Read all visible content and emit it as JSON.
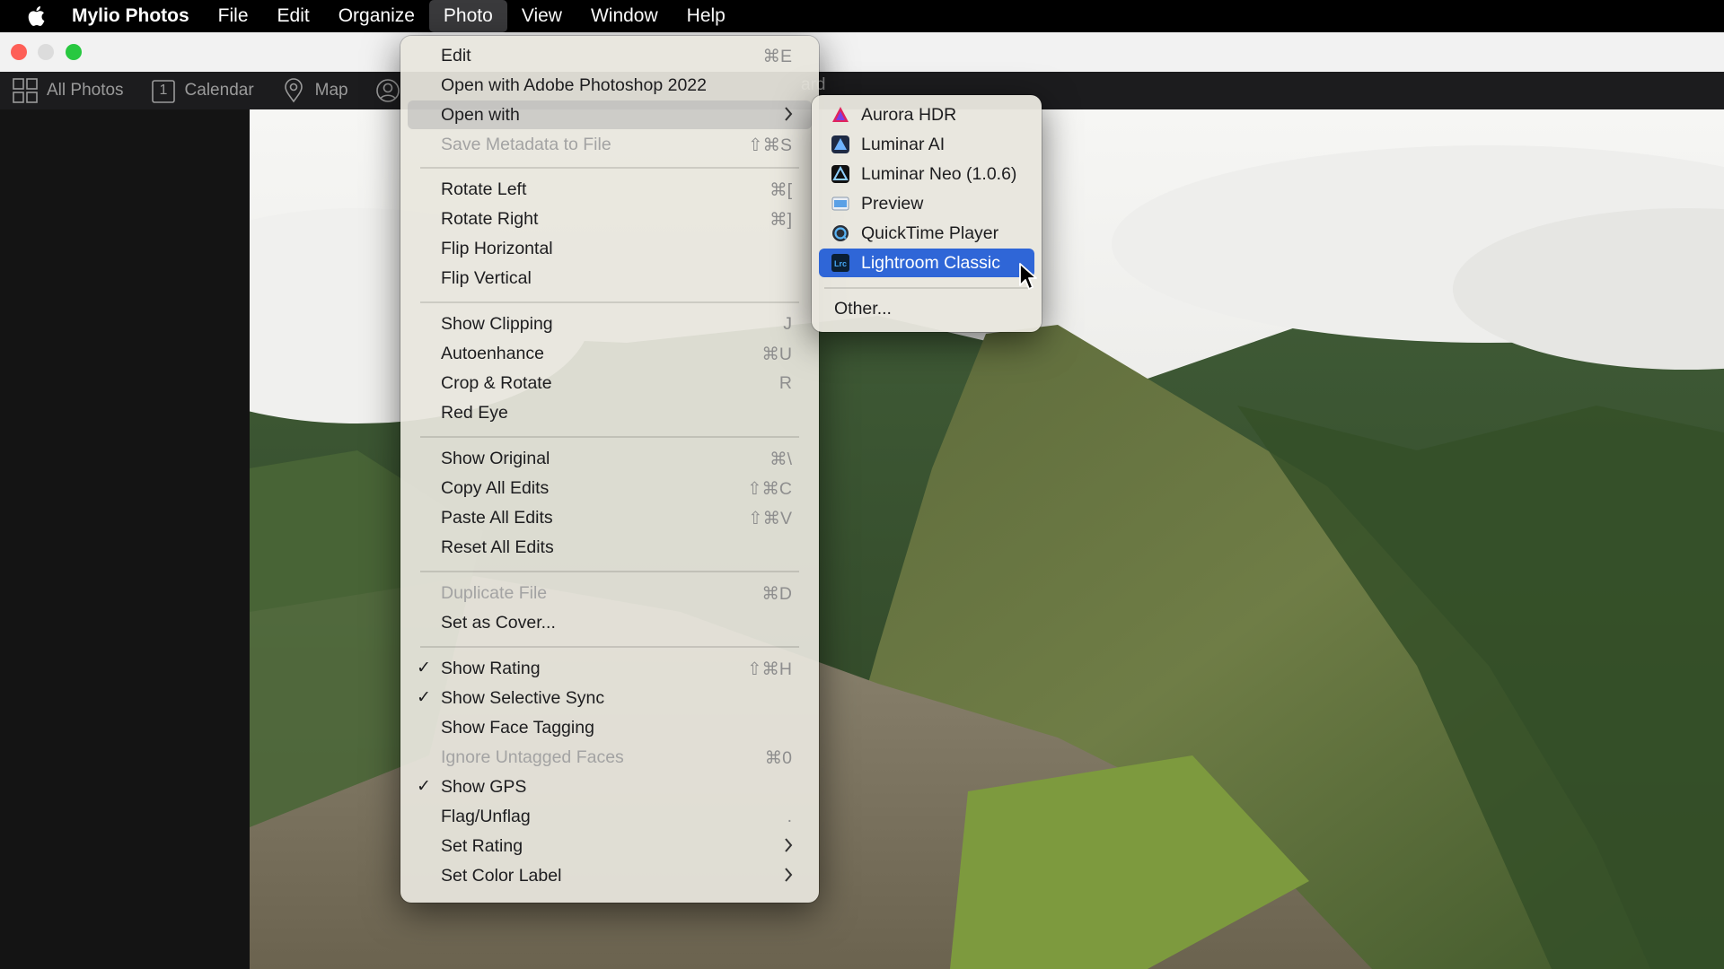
{
  "menubar": {
    "app_name": "Mylio Photos",
    "menus": [
      "File",
      "Edit",
      "Organize",
      "Photo",
      "View",
      "Window",
      "Help"
    ],
    "active_menu": "Photo"
  },
  "toolbar": {
    "all_photos": "All Photos",
    "calendar": "Calendar",
    "calendar_day": "1",
    "map": "Map",
    "partial_label": "ard"
  },
  "photo_menu": {
    "items": [
      {
        "label": "Edit",
        "shortcut": "⌘E"
      },
      {
        "label": "Open with Adobe Photoshop 2022",
        "shortcut": ""
      },
      {
        "label": "Open with",
        "shortcut": ""
      },
      {
        "label": "Save Metadata to File",
        "shortcut": "⇧⌘S"
      },
      {
        "label": "Rotate Left",
        "shortcut": "⌘["
      },
      {
        "label": "Rotate Right",
        "shortcut": "⌘]"
      },
      {
        "label": "Flip Horizontal",
        "shortcut": ""
      },
      {
        "label": "Flip Vertical",
        "shortcut": ""
      },
      {
        "label": "Show Clipping",
        "shortcut": "J"
      },
      {
        "label": "Autoenhance",
        "shortcut": "⌘U"
      },
      {
        "label": "Crop & Rotate",
        "shortcut": "R"
      },
      {
        "label": "Red Eye",
        "shortcut": ""
      },
      {
        "label": "Show Original",
        "shortcut": "⌘\\"
      },
      {
        "label": "Copy All Edits",
        "shortcut": "⇧⌘C"
      },
      {
        "label": "Paste All Edits",
        "shortcut": "⇧⌘V"
      },
      {
        "label": "Reset All Edits",
        "shortcut": ""
      },
      {
        "label": "Duplicate File",
        "shortcut": "⌘D"
      },
      {
        "label": "Set as Cover...",
        "shortcut": ""
      },
      {
        "label": "Show Rating",
        "shortcut": "⇧⌘H"
      },
      {
        "label": "Show Selective Sync",
        "shortcut": ""
      },
      {
        "label": "Show Face Tagging",
        "shortcut": ""
      },
      {
        "label": "Ignore Untagged Faces",
        "shortcut": "⌘0"
      },
      {
        "label": "Show GPS",
        "shortcut": ""
      },
      {
        "label": "Flag/Unflag",
        "shortcut": "."
      },
      {
        "label": "Set Rating",
        "shortcut": ""
      },
      {
        "label": "Set Color Label",
        "shortcut": ""
      }
    ],
    "checkmark": "✓"
  },
  "open_with_menu": {
    "items": [
      "Aurora HDR",
      "Luminar AI",
      "Luminar Neo (1.0.6)",
      "Preview",
      "QuickTime Player",
      "Lightroom Classic",
      "Other..."
    ],
    "lrc_badge": "Lrc"
  },
  "colors": {
    "selection": "#2f66d7",
    "close": "#fe5f57",
    "zoom": "#28c840"
  }
}
